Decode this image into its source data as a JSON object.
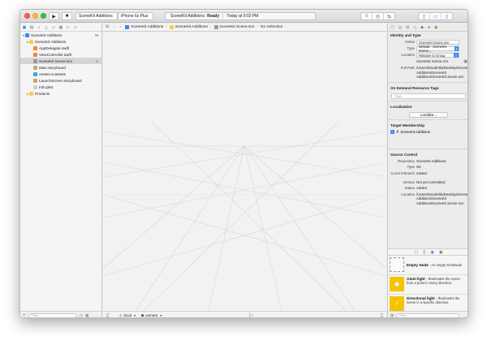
{
  "toolbar": {
    "scheme_target": "SceneKit Additions",
    "scheme_device": "iPhone 6s Plus",
    "activity_name": "SceneKit Additions:",
    "activity_state": "Ready",
    "activity_time": "Today at 9:02 PM"
  },
  "navigator": {
    "project": {
      "label": "SceneKit Additions",
      "badge": "M"
    },
    "group": {
      "label": "SceneKit Additions"
    },
    "files": [
      {
        "label": "AppDelegate.swift",
        "badge": ""
      },
      {
        "label": "ViewController.swift",
        "badge": ""
      },
      {
        "label": "SceneKit Scene.scn",
        "badge": "A"
      },
      {
        "label": "Main.storyboard",
        "badge": ""
      },
      {
        "label": "Assets.xcassets",
        "badge": ""
      },
      {
        "label": "LaunchScreen.storyboard",
        "badge": ""
      },
      {
        "label": "Info.plist",
        "badge": ""
      }
    ],
    "products": {
      "label": "Products"
    },
    "filter_placeholder": "Filter"
  },
  "jumpbar": {
    "crumbs": [
      "SceneKit Additions",
      "SceneKit Additions",
      "SceneKit Scene.scn",
      "No Selection"
    ]
  },
  "scene_bar": {
    "space": "local",
    "camera": "camera"
  },
  "inspector": {
    "identity": {
      "title": "Identity and Type",
      "name_label": "Name",
      "name_value": "SceneKit Scene.scn",
      "type_label": "Type",
      "type_value": "Default - SceneKit Scene...",
      "location_label": "Location",
      "location_value": "Relative to Group",
      "location_file": "SceneKit Scene.scn",
      "fullpath_label": "Full Path",
      "fullpath_value": "/Users/DavidAlla/Desktop/SceneKit Additions/SceneKit Additions/SceneKit Scene.scn"
    },
    "odr": {
      "title": "On Demand Resource Tags",
      "placeholder": "Tags"
    },
    "localization": {
      "title": "Localization",
      "button": "Localize..."
    },
    "membership": {
      "title": "Target Membership",
      "target": "SceneKit Additions"
    },
    "source_control": {
      "title": "Source Control",
      "repository_label": "Repository",
      "repository_value": "SceneKit Additions",
      "type_label": "Type",
      "type_value": "Git",
      "branch_label": "Current Branch",
      "branch_value": "master",
      "version_label": "Version",
      "version_value": "Not yet committed",
      "status_label": "Status",
      "status_value": "Added",
      "location_label": "Location",
      "location_value": "/Users/DavidAlla/Desktop/SceneKit Additions/SceneKit Additions/SceneKit Scene.scn"
    }
  },
  "library": {
    "items": [
      {
        "title": "Empty Node",
        "desc": "- An empty SCNNode."
      },
      {
        "title": "Omni light",
        "desc": "- Illuminates the scene from a point in every direction."
      },
      {
        "title": "Directional light",
        "desc": "- Illuminates the scene in a specific direction."
      }
    ],
    "filter_placeholder": "Filter"
  },
  "colors": {
    "accent": "#1c7cf4",
    "light_yellow": "#f5c400"
  }
}
